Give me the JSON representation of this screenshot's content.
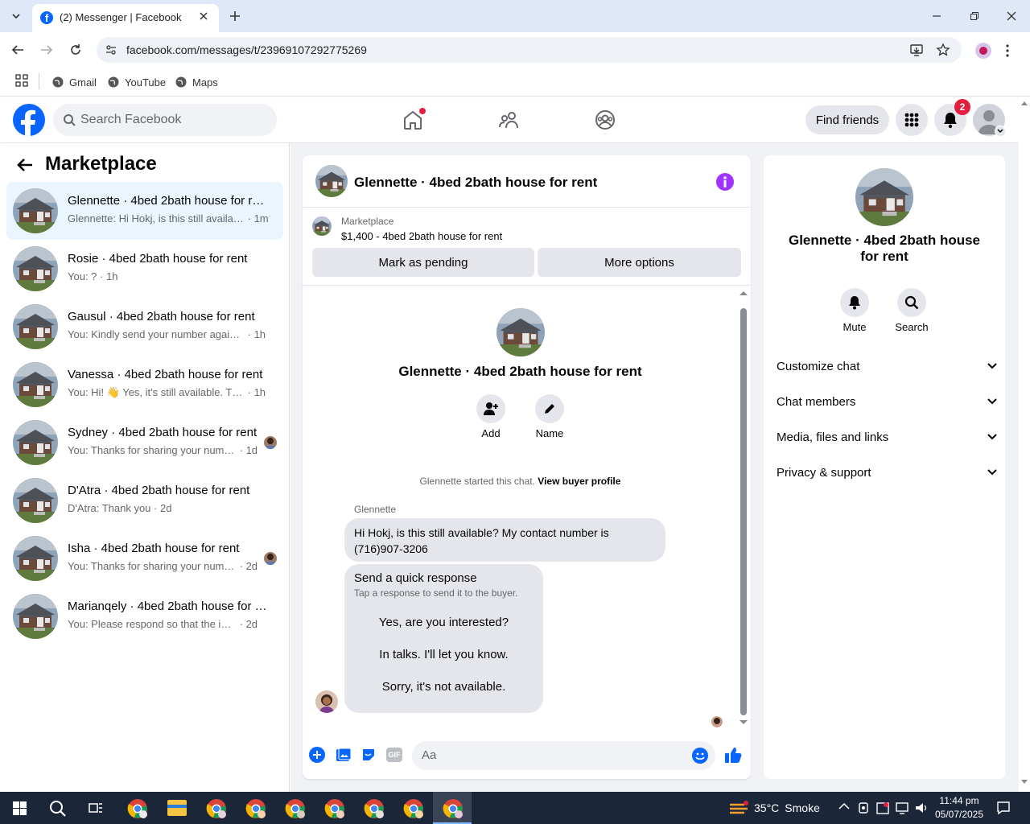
{
  "browser": {
    "tab_title": "(2) Messenger | Facebook",
    "url": "facebook.com/messages/t/23969107292775269",
    "bookmarks": [
      "Gmail",
      "YouTube",
      "Maps"
    ]
  },
  "fb_header": {
    "search_placeholder": "Search Facebook",
    "find_friends": "Find friends",
    "notification_count": "2"
  },
  "left_panel": {
    "title": "Marketplace",
    "conversations": [
      {
        "name": "Glennette · 4bed 2bath house for rent",
        "preview": "Glennette: Hi Hokj, is this still available? My contact number is",
        "time": "1m",
        "active": true
      },
      {
        "name": "Rosie · 4bed 2bath house for rent",
        "preview": "You: ?",
        "time": "1h"
      },
      {
        "name": "Gausul · 4bed 2bath house for rent",
        "preview": "You: Kindly send your number again so I can contact you",
        "time": "1h"
      },
      {
        "name": "Vanessa · 4bed 2bath house for rent",
        "preview": "You: Hi! 👋 Yes, it's still available. That's why I asked",
        "time": "1h"
      },
      {
        "name": "Sydney · 4bed 2bath house for rent",
        "preview": "You: Thanks for sharing your number",
        "time": "1d"
      },
      {
        "name": "D'Atra · 4bed 2bath house for rent",
        "preview": "D'Atra: Thank you",
        "time": "2d"
      },
      {
        "name": "Isha · 4bed 2bath house for rent",
        "preview": "You: Thanks for sharing your number",
        "time": "2d"
      },
      {
        "name": "Marianqely · 4bed 2bath house for rent",
        "preview": "You: Please respond so that the information can be shared",
        "time": "2d"
      }
    ]
  },
  "chat": {
    "title": "Glennette · 4bed 2bath house for rent",
    "listing_label": "Marketplace",
    "listing_detail": "$1,400 - 4bed 2bath house for rent",
    "mark_pending": "Mark as pending",
    "more_options": "More options",
    "profile_name": "Glennette · 4bed 2bath house for rent",
    "add_label": "Add",
    "name_label": "Name",
    "started_text": "Glennette started this chat.",
    "view_buyer": "View buyer profile",
    "sender": "Glennette",
    "message": "Hi Hokj, is this still available? My contact number is (716)907-3206",
    "quick_title": "Send a quick response",
    "quick_sub": "Tap a response to send it to the buyer.",
    "quick_responses": [
      "Yes, are you interested?",
      "In talks. I'll let you know.",
      "Sorry, it's not available."
    ],
    "composer_placeholder": "Aa"
  },
  "info_panel": {
    "name": "Glennette · 4bed 2bath house for rent",
    "mute": "Mute",
    "search": "Search",
    "sections": [
      "Customize chat",
      "Chat members",
      "Media, files and links",
      "Privacy & support"
    ]
  },
  "taskbar": {
    "temperature": "35°C",
    "weather": "Smoke",
    "time": "11:44 pm",
    "date": "05/07/2025"
  },
  "colors": {
    "fb_blue": "#0866ff",
    "accent_purple": "#a033ff",
    "badge_red": "#e41e3f"
  }
}
